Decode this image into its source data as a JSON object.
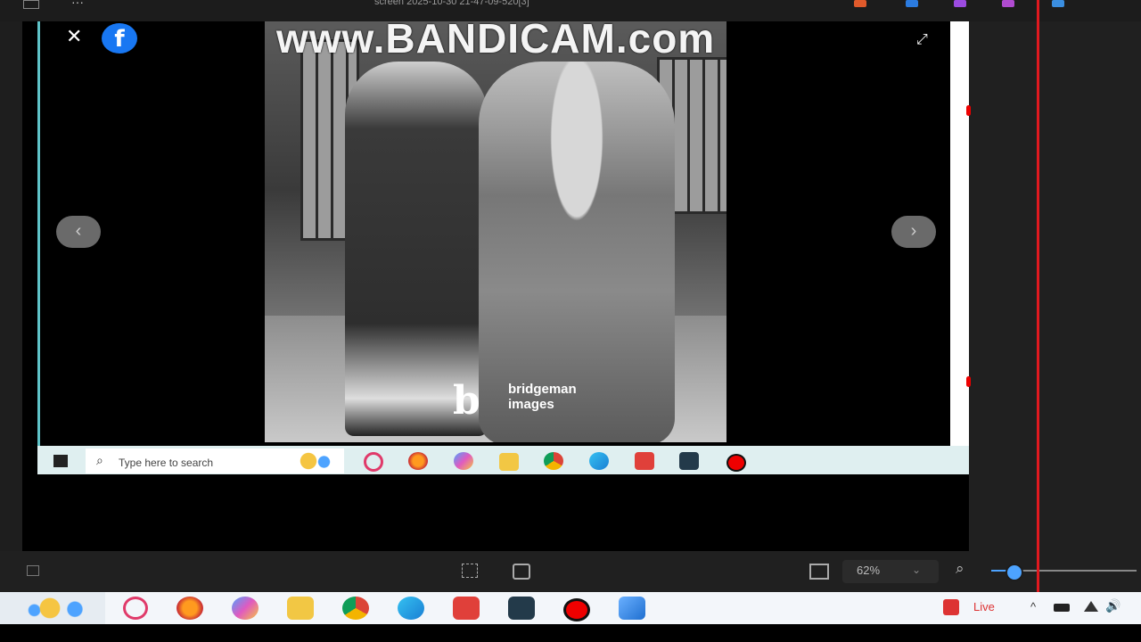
{
  "window": {
    "title": "screen 2025-10-30 21-47-09-520[3]"
  },
  "watermark": "www.BANDICAM.com",
  "photo": {
    "logo_mark": "b",
    "brand_line1": "bridgeman",
    "brand_line2": "images"
  },
  "viewer": {
    "close_glyph": "✕",
    "facebook_glyph": "f",
    "prev_glyph": "‹",
    "next_glyph": "›",
    "expand_glyph": "⤢"
  },
  "inner_taskbar": {
    "search_placeholder": "Type here to search",
    "search_glyph": "⌕"
  },
  "statusbar": {
    "zoom_value": "62%",
    "zoom_caret": "⌄",
    "zoom_glyph": "⌕"
  },
  "taskbar": {
    "live_label": "Live",
    "caret": "^",
    "volume_glyph": "🔊"
  },
  "colors": {
    "accent": "#4da3ff",
    "facebook": "#1877f2",
    "red_line": "#e0191f"
  }
}
